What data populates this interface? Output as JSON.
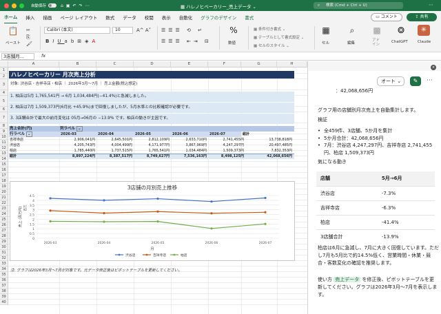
{
  "window": {
    "autosave_label": "自動保存",
    "title": "ハレノヒベーカリー_売上データ",
    "search_placeholder": "検索 (Cmd + Ctrl + U)"
  },
  "tabs": [
    "ホーム",
    "挿入",
    "描画",
    "ページ レイアウト",
    "数式",
    "データ",
    "校閲",
    "表示",
    "自動化",
    "グラフのデザイン",
    "書式"
  ],
  "header_buttons": {
    "comment": "コメント",
    "share": "共有"
  },
  "ribbon": {
    "paste": "ペースト",
    "font": "Calibri (本文)",
    "size": "10",
    "cond_format": "条件付き書式",
    "table_format": "テーブルとして書式設定",
    "cell_style": "セルのスタイル",
    "number": "数値",
    "cells": "セル",
    "edit": "編集",
    "addin": "アド\nイン",
    "chatgpt": "ChatGPT",
    "claude": "Claude"
  },
  "formula_bar": {
    "namebox": "3店舗月...",
    "fx": "fx"
  },
  "sheet": {
    "columns": [
      "A",
      "B",
      "C",
      "D",
      "E",
      "F",
      "G",
      "H"
    ],
    "rows": [
      "1",
      "2",
      "3",
      "4",
      "5",
      "6",
      "7",
      "8",
      "9",
      "10",
      "11",
      "12",
      "13",
      "14",
      "15",
      "16",
      "17",
      "18",
      "19",
      "20",
      "21",
      "22",
      "23",
      "24",
      "25",
      "26",
      "27",
      "28",
      "29",
      "30",
      "31",
      "32",
      "33",
      "34",
      "35",
      "36",
      "37",
      "38",
      "39",
      "40"
    ],
    "title": "ハレノヒベーカリー 月次売上分析",
    "subtitle": "対象: 渋谷店・吉祥寺店・柏店 ｜ 2026年3月〜7月 ｜ 売上金額(税込想定)",
    "notes": [
      "1. 柏店は5月 1,765,541円 → 6月 1,034,484円(−41.4%)と急減しました。",
      "2. 柏店は7月 1,509,373円(6月比 +45.9%)まで回復しましたが、5月水準との比較確認が必要です。",
      "3. 3店舗合計で最大の前月変化は 05月→06月の −13.9% です。柏店の動きが主因です。"
    ],
    "pivot": {
      "sum_label": "売上合計(円)",
      "col_label": "列ラベル",
      "row_label": "行ラベル",
      "months": [
        "2026-03",
        "2026-04",
        "2026-05",
        "2026-06",
        "2026-07"
      ],
      "total_label": "総計",
      "rows": [
        {
          "name": "吉祥寺店",
          "values": [
            "2,906,041円",
            "2,645,501円",
            "2,812,109円",
            "2,633,710円",
            "2,741,455円",
            "13,738,818円"
          ]
        },
        {
          "name": "渋谷店",
          "values": [
            "4,205,743円",
            "4,004,499円",
            "4,171,977円",
            "3,867,969円",
            "4,247,297円",
            "20,497,485円"
          ]
        },
        {
          "name": "柏店",
          "values": [
            "1,785,440円",
            "1,737,515円",
            "1,765,541円",
            "1,034,484円",
            "1,509,373円",
            "7,832,353円"
          ]
        },
        {
          "name": "総計",
          "values": [
            "8,897,224円",
            "8,387,517円",
            "8,749,627円",
            "7,536,163円",
            "8,498,125円",
            "42,068,656円"
          ]
        }
      ]
    },
    "bottom_note": "注: グラフは2026年3月〜7月が対象です。元データ修正後はピボットテーブルを更新してください。"
  },
  "chart_data": {
    "type": "line",
    "title": "3店舗の月別売上推移",
    "xlabel": "月",
    "ylabel": "売上 (百万円)",
    "ylabel_unit": "百万",
    "x": [
      "2026-03",
      "2026-04",
      "2026-05",
      "2026-06",
      "2026-07"
    ],
    "ylim": [
      0,
      4.5
    ],
    "yticks": [
      "0",
      "0.5",
      "1",
      "1.5",
      "2",
      "2.5",
      "3",
      "3.5",
      "4",
      "4.5"
    ],
    "series": [
      {
        "name": "渋谷店",
        "color": "#4472c4",
        "values": [
          4.21,
          4.0,
          4.17,
          3.87,
          4.25
        ]
      },
      {
        "name": "吉祥寺店",
        "color": "#c55a11",
        "values": [
          2.91,
          2.65,
          2.81,
          2.63,
          2.74
        ]
      },
      {
        "name": "柏店",
        "color": "#70ad47",
        "values": [
          1.79,
          1.74,
          1.77,
          1.03,
          1.51
        ]
      }
    ],
    "grid": true,
    "legend": "bottom"
  },
  "pane": {
    "mode": "オート",
    "total_cut": "：42,068,656円",
    "summary": "グラフ用の店舗別月次売上を自動集計します。",
    "verify_title": "検証",
    "bullets": [
      "全459件、3店舗、5か月を集計",
      "5か月合計：42,068,656円",
      "7月：渋谷店 4,247,297円、吉祥寺店 2,741,455円、柏店 1,509,373円"
    ],
    "concern_title": "気になる動き",
    "table": {
      "headers": [
        "店舗",
        "5月→6月"
      ],
      "rows": [
        [
          "渋谷店",
          "-7.3%"
        ],
        [
          "吉祥寺店",
          "-6.3%"
        ],
        [
          "柏店",
          "-41.4%"
        ],
        [
          "3店舗合計",
          "-13.9%"
        ]
      ]
    },
    "analysis": "柏店は6月に急減し、7月に大きく回復しています。ただし7月も5月比で約14.5%低く、営業時間・休業・競合・客数変化の確認を推奨します。",
    "usage_prefix": "使い方",
    "usage_sheet": "売上データ",
    "usage_rest": "を修正後、ピボットテーブルを更新してください。グラフは2026年3月〜7月を表示します。"
  }
}
